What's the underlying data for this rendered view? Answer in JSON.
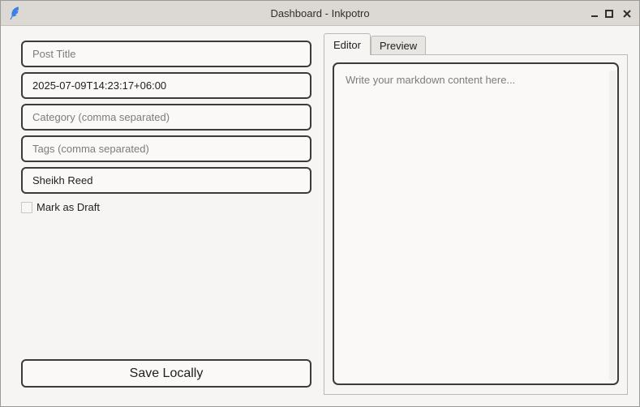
{
  "window": {
    "title": "Dashboard - Inkpotro",
    "app_icon": "feather-icon",
    "controls": [
      "minimize-icon",
      "maximize-icon",
      "close-icon"
    ]
  },
  "form": {
    "post_title": {
      "value": "",
      "placeholder": "Post Title"
    },
    "date": {
      "value": "2025-07-09T14:23:17+06:00",
      "placeholder": ""
    },
    "category": {
      "value": "",
      "placeholder": "Category (comma separated)"
    },
    "tags": {
      "value": "",
      "placeholder": "Tags (comma separated)"
    },
    "author": {
      "value": "Sheikh Reed",
      "placeholder": ""
    },
    "draft": {
      "label": "Mark as Draft",
      "checked": false
    },
    "save_label": "Save Locally"
  },
  "tabs": [
    {
      "label": "Editor",
      "active": true
    },
    {
      "label": "Preview",
      "active": false
    }
  ],
  "editor": {
    "value": "",
    "placeholder": "Write your markdown content here..."
  },
  "colors": {
    "icon_accent": "#3d7fe6",
    "border_dark": "#3b3b3b",
    "titlebar": "#dcd9d5"
  }
}
